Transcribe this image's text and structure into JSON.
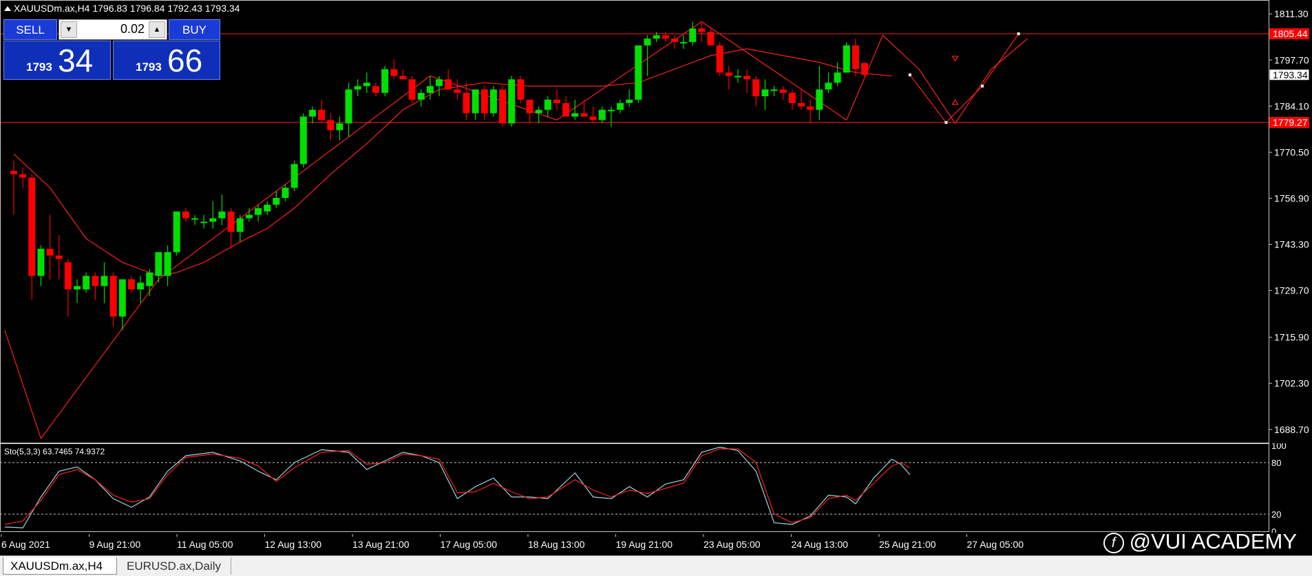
{
  "chart": {
    "title": "XAUUSDm.ax,H4  1796.83 1796.84 1792.43 1793.34",
    "grid": false
  },
  "trade_panel": {
    "sell_label": "SELL",
    "buy_label": "BUY",
    "lot": "0.02",
    "sell_price_small": "1793",
    "sell_price_big": "34",
    "buy_price_small": "1793",
    "buy_price_big": "66"
  },
  "price_axis": {
    "labels": [
      "1811.30",
      "1797.70",
      "1784.10",
      "1770.50",
      "1756.90",
      "1743.30",
      "1729.70",
      "1715.90",
      "1702.30",
      "1688.70"
    ],
    "markers": [
      {
        "text": "1805.44",
        "value": 1805.44,
        "bg": "#ff0000",
        "fg": "#ffffff"
      },
      {
        "text": "1793.34",
        "value": 1793.34,
        "bg": "#ffffff",
        "fg": "#000000"
      },
      {
        "text": "1779.27",
        "value": 1779.27,
        "bg": "#ff0000",
        "fg": "#ffffff"
      }
    ]
  },
  "oscillator": {
    "title": "Sto(5,3,3) 63.7465 74.9372",
    "levels": [
      "100",
      "80",
      "20",
      "0"
    ]
  },
  "time_axis": {
    "labels": [
      "6 Aug 2021",
      "9 Aug 21:00",
      "11 Aug 05:00",
      "12 Aug 13:00",
      "13 Aug 21:00",
      "17 Aug 05:00",
      "18 Aug 13:00",
      "19 Aug 21:00",
      "23 Aug 05:00",
      "24 Aug 13:00",
      "25 Aug 21:00",
      "27 Aug 05:00"
    ]
  },
  "tabs": [
    {
      "label": "XAUUSDm.ax,H4",
      "active": true
    },
    {
      "label": "EURUSD.ax,Daily",
      "active": false
    }
  ],
  "watermark": {
    "text": "@VUI ACADEMY",
    "logo": "f"
  },
  "colors": {
    "bull": "#00e000",
    "bear": "#ff0000",
    "line": "#ff2020",
    "stoch_main": "#9fd8e8",
    "stoch_signal": "#ff2020"
  },
  "chart_data": {
    "type": "candlestick",
    "ylim": [
      1685,
      1815
    ],
    "candles": [
      [
        1765,
        1768,
        1752,
        1764
      ],
      [
        1764,
        1766,
        1760,
        1763
      ],
      [
        1763,
        1764,
        1727,
        1734
      ],
      [
        1734,
        1743,
        1731,
        1742
      ],
      [
        1742,
        1752,
        1733,
        1740
      ],
      [
        1740,
        1746,
        1733,
        1739
      ],
      [
        1738,
        1739,
        1722,
        1730
      ],
      [
        1730,
        1733,
        1726,
        1731
      ],
      [
        1730,
        1735,
        1729,
        1734
      ],
      [
        1734,
        1735,
        1727,
        1731
      ],
      [
        1731,
        1738,
        1726,
        1734
      ],
      [
        1734,
        1735,
        1719,
        1722
      ],
      [
        1722,
        1732,
        1718,
        1733
      ],
      [
        1733,
        1734,
        1729,
        1730
      ],
      [
        1730,
        1734,
        1726,
        1732
      ],
      [
        1731,
        1736,
        1728,
        1735
      ],
      [
        1734,
        1740,
        1732,
        1741
      ],
      [
        1734,
        1743,
        1731,
        1741
      ],
      [
        1741,
        1753,
        1740,
        1753
      ],
      [
        1753,
        1754,
        1750,
        1751
      ],
      [
        1751,
        1752,
        1749,
        1751
      ],
      [
        1750,
        1752,
        1748,
        1750
      ],
      [
        1750,
        1756,
        1748,
        1751
      ],
      [
        1751,
        1758,
        1749,
        1753
      ],
      [
        1753,
        1754,
        1742,
        1747
      ],
      [
        1747,
        1752,
        1744,
        1751
      ],
      [
        1751,
        1754,
        1750,
        1752
      ],
      [
        1752,
        1755,
        1750,
        1754
      ],
      [
        1753,
        1756,
        1752,
        1755
      ],
      [
        1755,
        1759,
        1754,
        1757
      ],
      [
        1757,
        1761,
        1756,
        1760
      ],
      [
        1760,
        1768,
        1759,
        1767
      ],
      [
        1767,
        1782,
        1766,
        1781
      ],
      [
        1781,
        1784,
        1779,
        1783
      ],
      [
        1783,
        1786,
        1779,
        1780
      ],
      [
        1780,
        1782,
        1774,
        1777
      ],
      [
        1777,
        1781,
        1774,
        1779
      ],
      [
        1779,
        1791,
        1775,
        1789
      ],
      [
        1789,
        1792,
        1787,
        1790
      ],
      [
        1790,
        1794,
        1788,
        1791
      ],
      [
        1790,
        1791,
        1787,
        1788
      ],
      [
        1788,
        1796,
        1787,
        1795
      ],
      [
        1795,
        1798,
        1792,
        1793
      ],
      [
        1793,
        1795,
        1792,
        1792
      ],
      [
        1792,
        1793,
        1785,
        1786
      ],
      [
        1786,
        1789,
        1784,
        1788
      ],
      [
        1788,
        1793,
        1786,
        1790
      ],
      [
        1790,
        1793,
        1787,
        1792
      ],
      [
        1792,
        1795,
        1789,
        1789
      ],
      [
        1789,
        1792,
        1786,
        1788
      ],
      [
        1788,
        1791,
        1780,
        1782
      ],
      [
        1782,
        1789,
        1780,
        1789
      ],
      [
        1789,
        1790,
        1780,
        1782
      ],
      [
        1782,
        1790,
        1781,
        1789
      ],
      [
        1789,
        1790,
        1778,
        1779
      ],
      [
        1779,
        1793,
        1778,
        1792
      ],
      [
        1792,
        1793,
        1785,
        1786
      ],
      [
        1786,
        1786,
        1779,
        1782
      ],
      [
        1782,
        1784,
        1779,
        1783
      ],
      [
        1783,
        1787,
        1781,
        1786
      ],
      [
        1786,
        1789,
        1783,
        1785
      ],
      [
        1785,
        1787,
        1781,
        1781
      ],
      [
        1781,
        1786,
        1780,
        1782
      ],
      [
        1782,
        1786,
        1781,
        1781
      ],
      [
        1781,
        1784,
        1779,
        1780
      ],
      [
        1780,
        1784,
        1779,
        1783
      ],
      [
        1783,
        1784,
        1778,
        1783
      ],
      [
        1783,
        1786,
        1782,
        1785
      ],
      [
        1785,
        1789,
        1784,
        1786
      ],
      [
        1786,
        1802,
        1785,
        1802
      ],
      [
        1802,
        1805,
        1793,
        1804
      ],
      [
        1804,
        1806,
        1803,
        1805
      ],
      [
        1805,
        1806,
        1803,
        1804
      ],
      [
        1804,
        1805,
        1801,
        1803
      ],
      [
        1803,
        1805,
        1801,
        1803
      ],
      [
        1803,
        1809,
        1802,
        1807
      ],
      [
        1807,
        1809,
        1803,
        1806
      ],
      [
        1806,
        1807,
        1802,
        1802
      ],
      [
        1802,
        1803,
        1793,
        1794
      ],
      [
        1794,
        1796,
        1789,
        1793
      ],
      [
        1793,
        1795,
        1791,
        1793
      ],
      [
        1793,
        1795,
        1788,
        1792
      ],
      [
        1792,
        1793,
        1784,
        1787
      ],
      [
        1787,
        1792,
        1783,
        1789
      ],
      [
        1789,
        1790,
        1787,
        1789
      ],
      [
        1789,
        1790,
        1786,
        1788
      ],
      [
        1788,
        1789,
        1783,
        1785
      ],
      [
        1785,
        1789,
        1783,
        1784
      ],
      [
        1784,
        1786,
        1779,
        1783
      ],
      [
        1783,
        1796,
        1780,
        1789
      ],
      [
        1789,
        1794,
        1788,
        1791
      ],
      [
        1791,
        1797,
        1790,
        1794
      ],
      [
        1794,
        1803,
        1794,
        1802
      ],
      [
        1802,
        1804,
        1793,
        1795
      ],
      [
        1796.83,
        1796.84,
        1792.43,
        1793.34
      ]
    ],
    "zigzag": [
      [
        -1,
        1718
      ],
      [
        3,
        1686
      ],
      [
        16,
        1733
      ],
      [
        46,
        1793
      ],
      [
        60,
        1780
      ],
      [
        76,
        1809
      ],
      [
        92,
        1780
      ],
      [
        96,
        1805
      ],
      [
        100,
        1795
      ],
      [
        104,
        1779
      ],
      [
        108,
        1795
      ],
      [
        112,
        1804
      ]
    ],
    "ma": [
      [
        0,
        1770
      ],
      [
        4,
        1760
      ],
      [
        8,
        1745
      ],
      [
        12,
        1738
      ],
      [
        16,
        1734
      ],
      [
        18,
        1735
      ],
      [
        21,
        1738
      ],
      [
        25,
        1744
      ],
      [
        28,
        1748
      ],
      [
        31,
        1754
      ],
      [
        35,
        1764
      ],
      [
        39,
        1773
      ],
      [
        43,
        1783
      ],
      [
        47,
        1789
      ],
      [
        52,
        1791
      ],
      [
        57,
        1790
      ],
      [
        61,
        1790
      ],
      [
        65,
        1790
      ],
      [
        69,
        1791
      ],
      [
        73,
        1795
      ],
      [
        77,
        1799
      ],
      [
        81,
        1801
      ],
      [
        85,
        1799
      ],
      [
        89,
        1797
      ],
      [
        93,
        1794
      ],
      [
        97,
        1793
      ]
    ],
    "stoch_main": [
      [
        -1,
        5
      ],
      [
        1,
        4
      ],
      [
        3,
        40
      ],
      [
        5,
        70
      ],
      [
        7,
        75
      ],
      [
        9,
        60
      ],
      [
        11,
        38
      ],
      [
        13,
        28
      ],
      [
        15,
        40
      ],
      [
        17,
        70
      ],
      [
        19,
        88
      ],
      [
        22,
        92
      ],
      [
        25,
        82
      ],
      [
        27,
        70
      ],
      [
        29,
        60
      ],
      [
        31,
        80
      ],
      [
        34,
        95
      ],
      [
        37,
        92
      ],
      [
        39,
        72
      ],
      [
        41,
        82
      ],
      [
        43,
        92
      ],
      [
        45,
        88
      ],
      [
        47,
        80
      ],
      [
        49,
        38
      ],
      [
        51,
        52
      ],
      [
        53,
        62
      ],
      [
        55,
        40
      ],
      [
        57,
        40
      ],
      [
        59,
        38
      ],
      [
        62,
        68
      ],
      [
        64,
        40
      ],
      [
        66,
        38
      ],
      [
        68,
        52
      ],
      [
        70,
        40
      ],
      [
        72,
        55
      ],
      [
        74,
        60
      ],
      [
        76,
        92
      ],
      [
        78,
        98
      ],
      [
        80,
        94
      ],
      [
        82,
        70
      ],
      [
        84,
        10
      ],
      [
        86,
        8
      ],
      [
        88,
        18
      ],
      [
        90,
        42
      ],
      [
        92,
        40
      ],
      [
        93,
        32
      ],
      [
        95,
        62
      ],
      [
        97,
        84
      ],
      [
        98,
        78
      ],
      [
        99,
        66
      ]
    ],
    "stoch_signal": [
      [
        -1,
        8
      ],
      [
        1,
        12
      ],
      [
        3,
        36
      ],
      [
        5,
        66
      ],
      [
        7,
        72
      ],
      [
        9,
        60
      ],
      [
        11,
        42
      ],
      [
        13,
        34
      ],
      [
        15,
        38
      ],
      [
        17,
        66
      ],
      [
        19,
        86
      ],
      [
        22,
        90
      ],
      [
        25,
        85
      ],
      [
        27,
        76
      ],
      [
        29,
        58
      ],
      [
        31,
        74
      ],
      [
        34,
        92
      ],
      [
        37,
        94
      ],
      [
        39,
        78
      ],
      [
        41,
        80
      ],
      [
        43,
        90
      ],
      [
        45,
        88
      ],
      [
        47,
        84
      ],
      [
        49,
        45
      ],
      [
        51,
        46
      ],
      [
        53,
        56
      ],
      [
        55,
        46
      ],
      [
        57,
        38
      ],
      [
        59,
        40
      ],
      [
        62,
        60
      ],
      [
        64,
        48
      ],
      [
        66,
        40
      ],
      [
        68,
        48
      ],
      [
        70,
        44
      ],
      [
        72,
        50
      ],
      [
        74,
        56
      ],
      [
        76,
        88
      ],
      [
        78,
        96
      ],
      [
        80,
        96
      ],
      [
        82,
        80
      ],
      [
        84,
        20
      ],
      [
        86,
        10
      ],
      [
        88,
        16
      ],
      [
        90,
        38
      ],
      [
        92,
        42
      ],
      [
        93,
        36
      ],
      [
        95,
        56
      ],
      [
        97,
        76
      ],
      [
        98,
        80
      ],
      [
        99,
        74
      ]
    ],
    "hlines": [
      1805.44,
      1779.27
    ],
    "projection": [
      [
        99,
        1793.34
      ],
      [
        103,
        1779.27
      ],
      [
        107,
        1790
      ],
      [
        111,
        1805.44
      ]
    ],
    "projection_arrows": [
      [
        104,
        1798,
        "down"
      ],
      [
        104,
        1785,
        "up"
      ]
    ]
  }
}
